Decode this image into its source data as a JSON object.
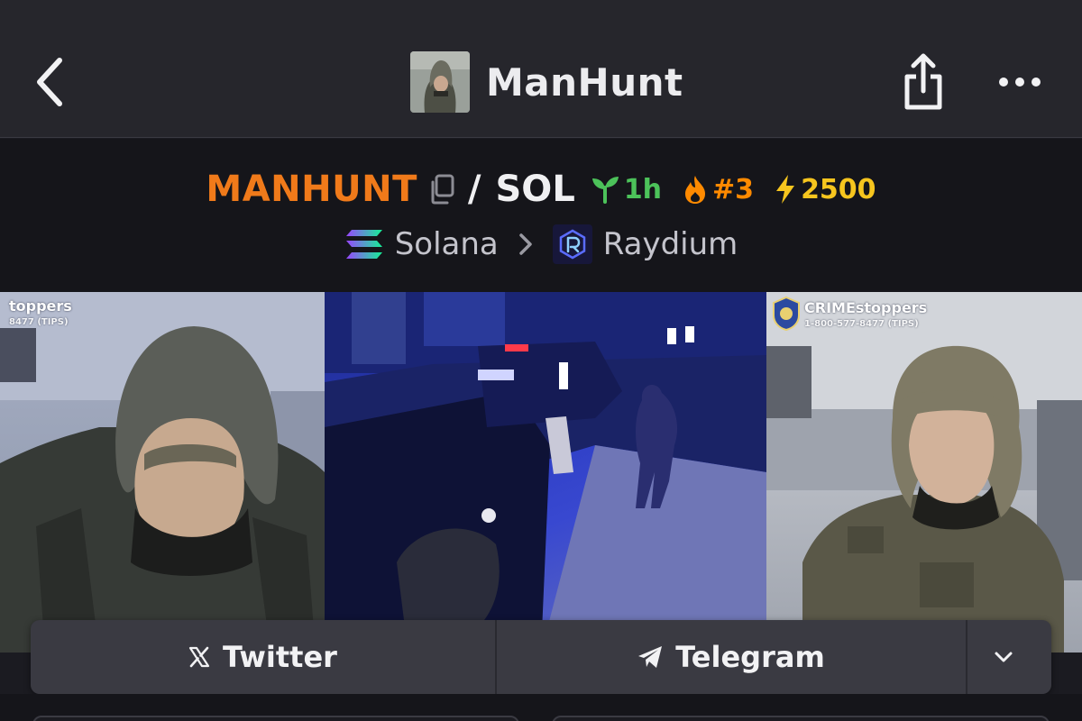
{
  "header": {
    "title": "ManHunt",
    "back_icon": "chevron-left-icon",
    "share_icon": "share-icon",
    "more_icon": "more-dots-icon"
  },
  "pair": {
    "base_symbol": "MANHUNT",
    "separator": "/",
    "quote_symbol": "SOL",
    "age": "1h",
    "rank": "#3",
    "boost": "2500",
    "colors": {
      "symbol": "#f07a1a",
      "age": "#4cc25a",
      "rank": "#ff8a00",
      "boost": "#f6c51e"
    }
  },
  "chain": {
    "name": "Solana",
    "dex": "Raydium"
  },
  "banner": {
    "watermark_left": "toppers",
    "watermark_left_phone": "8477 (TIPS)",
    "watermark_right": "CRIMEstoppers",
    "watermark_right_phone": "1-800-577-8477 (TIPS)"
  },
  "links": {
    "twitter": "Twitter",
    "telegram": "Telegram",
    "expand_icon": "chevron-down-icon"
  }
}
